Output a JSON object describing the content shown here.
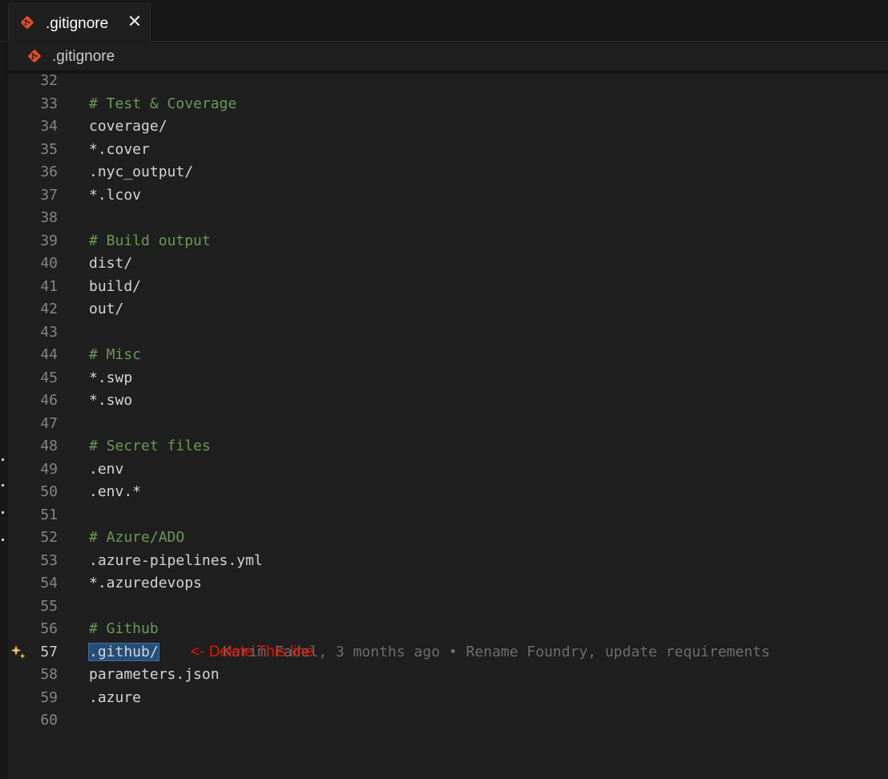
{
  "tab": {
    "label": ".gitignore",
    "close": "✕",
    "icon": "git-icon"
  },
  "breadcrumb": {
    "label": ".gitignore",
    "icon": "git-icon"
  },
  "colors": {
    "comment": "#6a9955",
    "text": "#d4d4d4",
    "line_number": "#858585",
    "selection": "#264f78",
    "annotation": "#e51400",
    "git_icon": "#e44d26"
  },
  "lines": [
    {
      "n": "32",
      "text": "",
      "type": "plain"
    },
    {
      "n": "33",
      "text": "# Test & Coverage",
      "type": "comment"
    },
    {
      "n": "34",
      "text": "coverage/",
      "type": "plain"
    },
    {
      "n": "35",
      "text": "*.cover",
      "type": "plain"
    },
    {
      "n": "36",
      "text": ".nyc_output/",
      "type": "plain"
    },
    {
      "n": "37",
      "text": "*.lcov",
      "type": "plain"
    },
    {
      "n": "38",
      "text": "",
      "type": "plain"
    },
    {
      "n": "39",
      "text": "# Build output",
      "type": "comment"
    },
    {
      "n": "40",
      "text": "dist/",
      "type": "plain"
    },
    {
      "n": "41",
      "text": "build/",
      "type": "plain"
    },
    {
      "n": "42",
      "text": "out/",
      "type": "plain"
    },
    {
      "n": "43",
      "text": "",
      "type": "plain"
    },
    {
      "n": "44",
      "text": "# Misc",
      "type": "comment"
    },
    {
      "n": "45",
      "text": "*.swp",
      "type": "plain"
    },
    {
      "n": "46",
      "text": "*.swo",
      "type": "plain"
    },
    {
      "n": "47",
      "text": "",
      "type": "plain"
    },
    {
      "n": "48",
      "text": "# Secret files",
      "type": "comment"
    },
    {
      "n": "49",
      "text": ".env",
      "type": "plain"
    },
    {
      "n": "50",
      "text": ".env.*",
      "type": "plain"
    },
    {
      "n": "51",
      "text": "",
      "type": "plain"
    },
    {
      "n": "52",
      "text": "# Azure/ADO",
      "type": "comment"
    },
    {
      "n": "53",
      "text": ".azure-pipelines.yml",
      "type": "plain"
    },
    {
      "n": "54",
      "text": "*.azuredevops",
      "type": "plain"
    },
    {
      "n": "55",
      "text": "",
      "type": "plain"
    },
    {
      "n": "56",
      "text": "# Github",
      "type": "comment"
    },
    {
      "n": "57",
      "text": ".github/",
      "type": "selected"
    },
    {
      "n": "58",
      "text": "parameters.json",
      "type": "plain"
    },
    {
      "n": "59",
      "text": ".azure",
      "type": "plain"
    },
    {
      "n": "60",
      "text": "",
      "type": "plain"
    }
  ],
  "active_line": {
    "blame": "Karim Fadel, 3 months ago • Rename Foundry, update requirements",
    "annotation": "<- Delete This line",
    "sparkle_icon": "sparkle-icon"
  }
}
